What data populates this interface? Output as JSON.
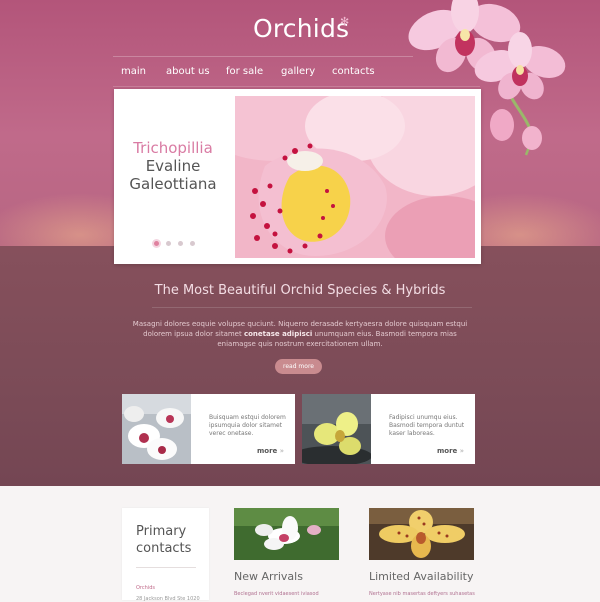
{
  "brand": {
    "logo": "Orchids",
    "logo_mark": "✻"
  },
  "nav": [
    {
      "label": "main"
    },
    {
      "label": "about us"
    },
    {
      "label": "for sale"
    },
    {
      "label": "gallery"
    },
    {
      "label": "contacts"
    }
  ],
  "slider": {
    "caption_line1": "Trichopillia",
    "caption_line2": "Evaline",
    "caption_line3": "Galeottiana",
    "dot_count": 4,
    "active_index": 0
  },
  "intro": {
    "title": "The Most Beautiful Orchid Species & Hybrids",
    "text_part1": "Masagni dolores eoquie volupse quciunt. Niquerro derasade kertyaesra dolore quisquam estqui dolorem ipsua dolor sitamet ",
    "text_bold": "conetase adipisci",
    "text_part2": " unumquam eius. Basmodi tempora mias eniamagse quis nostrum exercitationem ullam.",
    "button": "read more"
  },
  "features": [
    {
      "text": "Buisquam estqui dolorem ipsumquia dolor sitamet verec onetase.",
      "more": "more",
      "more_icon": "»"
    },
    {
      "text": "Fadipisci unumqu eius. Basmodi tempora duntut kaser laboreas.",
      "more": "more",
      "more_icon": "»"
    }
  ],
  "footer": {
    "contacts_title_1": "Primary",
    "contacts_title_2": "contacts",
    "contacts_name": "Orchids",
    "contacts_addr": "28 Jackson Blvd Ste 1020",
    "col2_title": "New Arrivals",
    "col2_sub": "Beclegad nverit vidaesent iviasod",
    "col3_title": "Limited Availability",
    "col3_sub": "Nertyase nib masertas deftyers suhasetas"
  },
  "colors": {
    "accent": "#d97ba3",
    "band_top": "#b3557a",
    "band_bottom": "#7b4b57",
    "button": "#c98b8f"
  }
}
